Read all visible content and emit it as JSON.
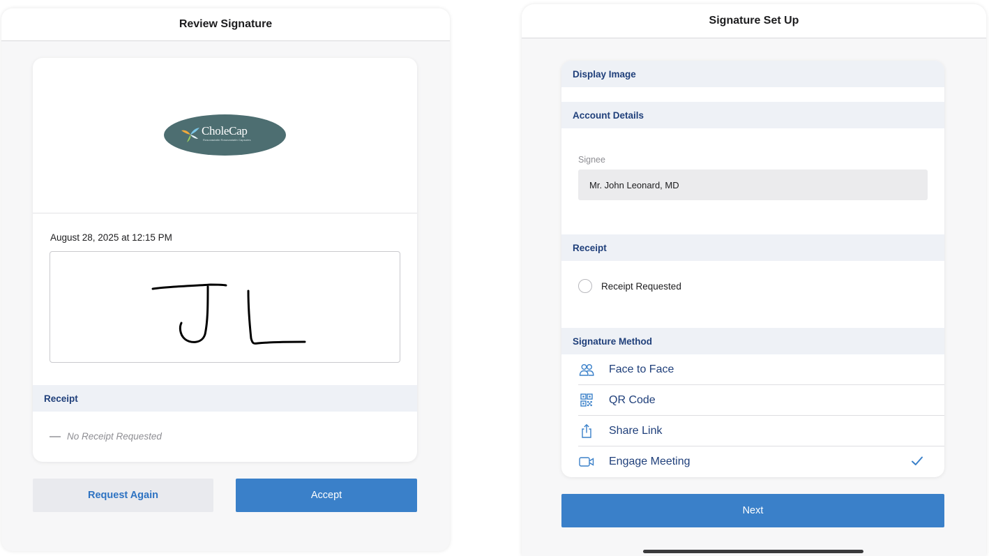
{
  "review": {
    "title": "Review Signature",
    "logo": {
      "brand": "CholeCap",
      "tagline": "Rosuvastatin Rosuvastatin Capsules"
    },
    "timestamp": "August 28, 2025 at 12:15 PM",
    "signature_initials": "JL",
    "receipt_header": "Receipt",
    "no_receipt_text": "No Receipt Requested",
    "request_again_label": "Request Again",
    "accept_label": "Accept"
  },
  "setup": {
    "title": "Signature Set Up",
    "display_image_header": "Display Image",
    "account_details_header": "Account Details",
    "signee_label": "Signee",
    "signee_value": "Mr. John Leonard, MD",
    "receipt_header": "Receipt",
    "receipt_option": "Receipt Requested",
    "receipt_checked": false,
    "method_header": "Signature Method",
    "methods": [
      {
        "label": "Face to Face",
        "icon": "people-icon",
        "selected": false
      },
      {
        "label": "QR Code",
        "icon": "qr-code-icon",
        "selected": false
      },
      {
        "label": "Share Link",
        "icon": "share-icon",
        "selected": false
      },
      {
        "label": "Engage Meeting",
        "icon": "video-camera-icon",
        "selected": true
      }
    ],
    "next_label": "Next"
  },
  "colors": {
    "accent": "#3a80c9",
    "header_text": "#1f3f7a",
    "section_bg": "#eef1f6",
    "logo_bg": "#4d6e71"
  }
}
